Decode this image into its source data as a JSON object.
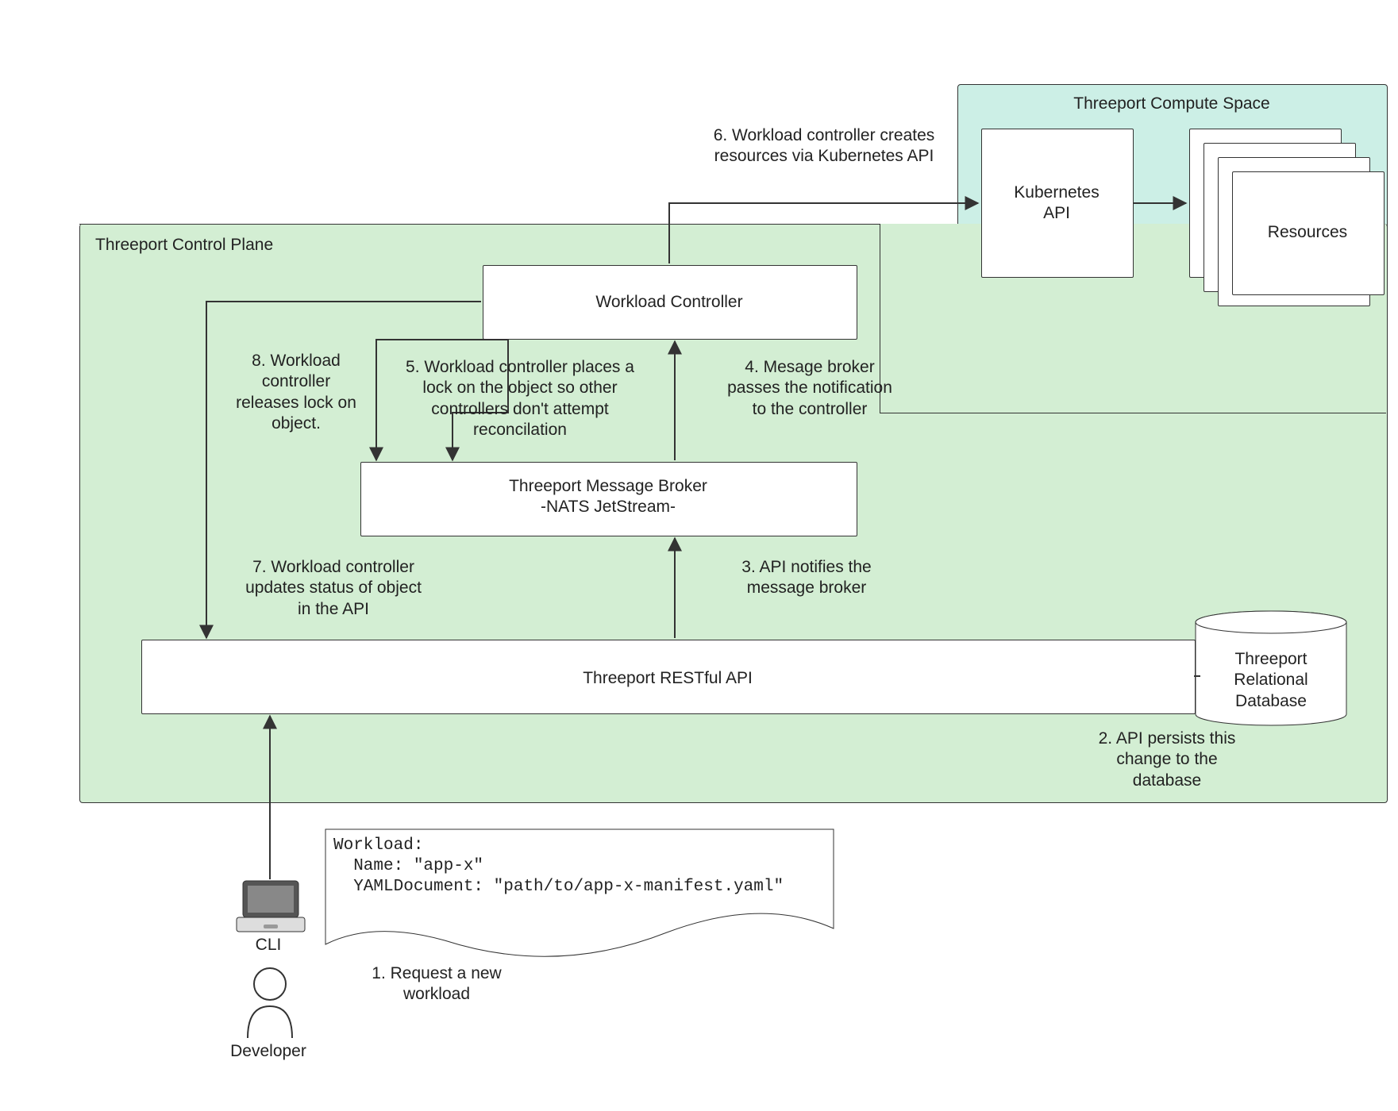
{
  "controlPlane": {
    "title": "Threeport Control Plane"
  },
  "computeSpace": {
    "title": "Threeport Compute Space"
  },
  "workloadController": {
    "label": "Workload Controller"
  },
  "messageBroker": {
    "label": "Threeport Message Broker\n-NATS JetStream-"
  },
  "restApi": {
    "label": "Threeport RESTful API"
  },
  "kubeApi": {
    "label": "Kubernetes\nAPI"
  },
  "resources": {
    "label": "Resources"
  },
  "database": {
    "label": "Threeport\nRelational\nDatabase"
  },
  "cli": {
    "label": "CLI"
  },
  "developer": {
    "label": "Developer"
  },
  "note": {
    "line1": "Workload:",
    "line2": "  Name: \"app-x\"",
    "line3": "  YAMLDocument: \"path/to/app-x-manifest.yaml\""
  },
  "steps": {
    "s1": "1. Request a new\nworkload",
    "s2": "2. API persists this\nchange to the\ndatabase",
    "s3": "3. API notifies the\nmessage broker",
    "s4": "4. Mesage broker\npasses the notification\nto the controller",
    "s5": "5. Workload controller places a\nlock on the object so other\ncontrollers don't attempt\nreconcilation",
    "s6": "6. Workload controller creates\nresources via Kubernetes API",
    "s7": "7. Workload controller\nupdates status of object\nin the API",
    "s8": "8. Workload\ncontroller\nreleases lock on\nobject."
  }
}
